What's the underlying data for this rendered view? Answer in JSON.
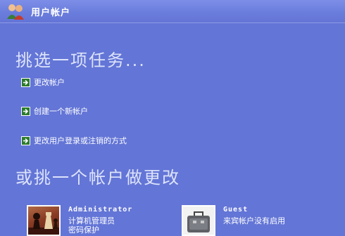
{
  "window": {
    "title": "用户帐户",
    "title_icon": "users-icon"
  },
  "tasks_section": {
    "heading": "挑选一项任务...",
    "tasks": [
      {
        "label": "更改帐户",
        "icon": "green-arrow-icon"
      },
      {
        "label": "创建一个新帐户",
        "icon": "green-arrow-icon"
      },
      {
        "label": "更改用户登录或注销的方式",
        "icon": "green-arrow-icon"
      }
    ]
  },
  "accounts_section": {
    "heading": "或挑一个帐户做更改",
    "accounts": [
      {
        "name": "Administrator",
        "line1": "计算机管理员",
        "line2": "密码保护",
        "avatar": "chess-pieces-icon"
      },
      {
        "name": "Guest",
        "line1": "来宾帐户没有启用",
        "avatar": "suitcase-icon"
      }
    ]
  },
  "colors": {
    "background": "#6375d6",
    "heading": "#dde3fb",
    "task_icon": "#2c7a2c"
  }
}
